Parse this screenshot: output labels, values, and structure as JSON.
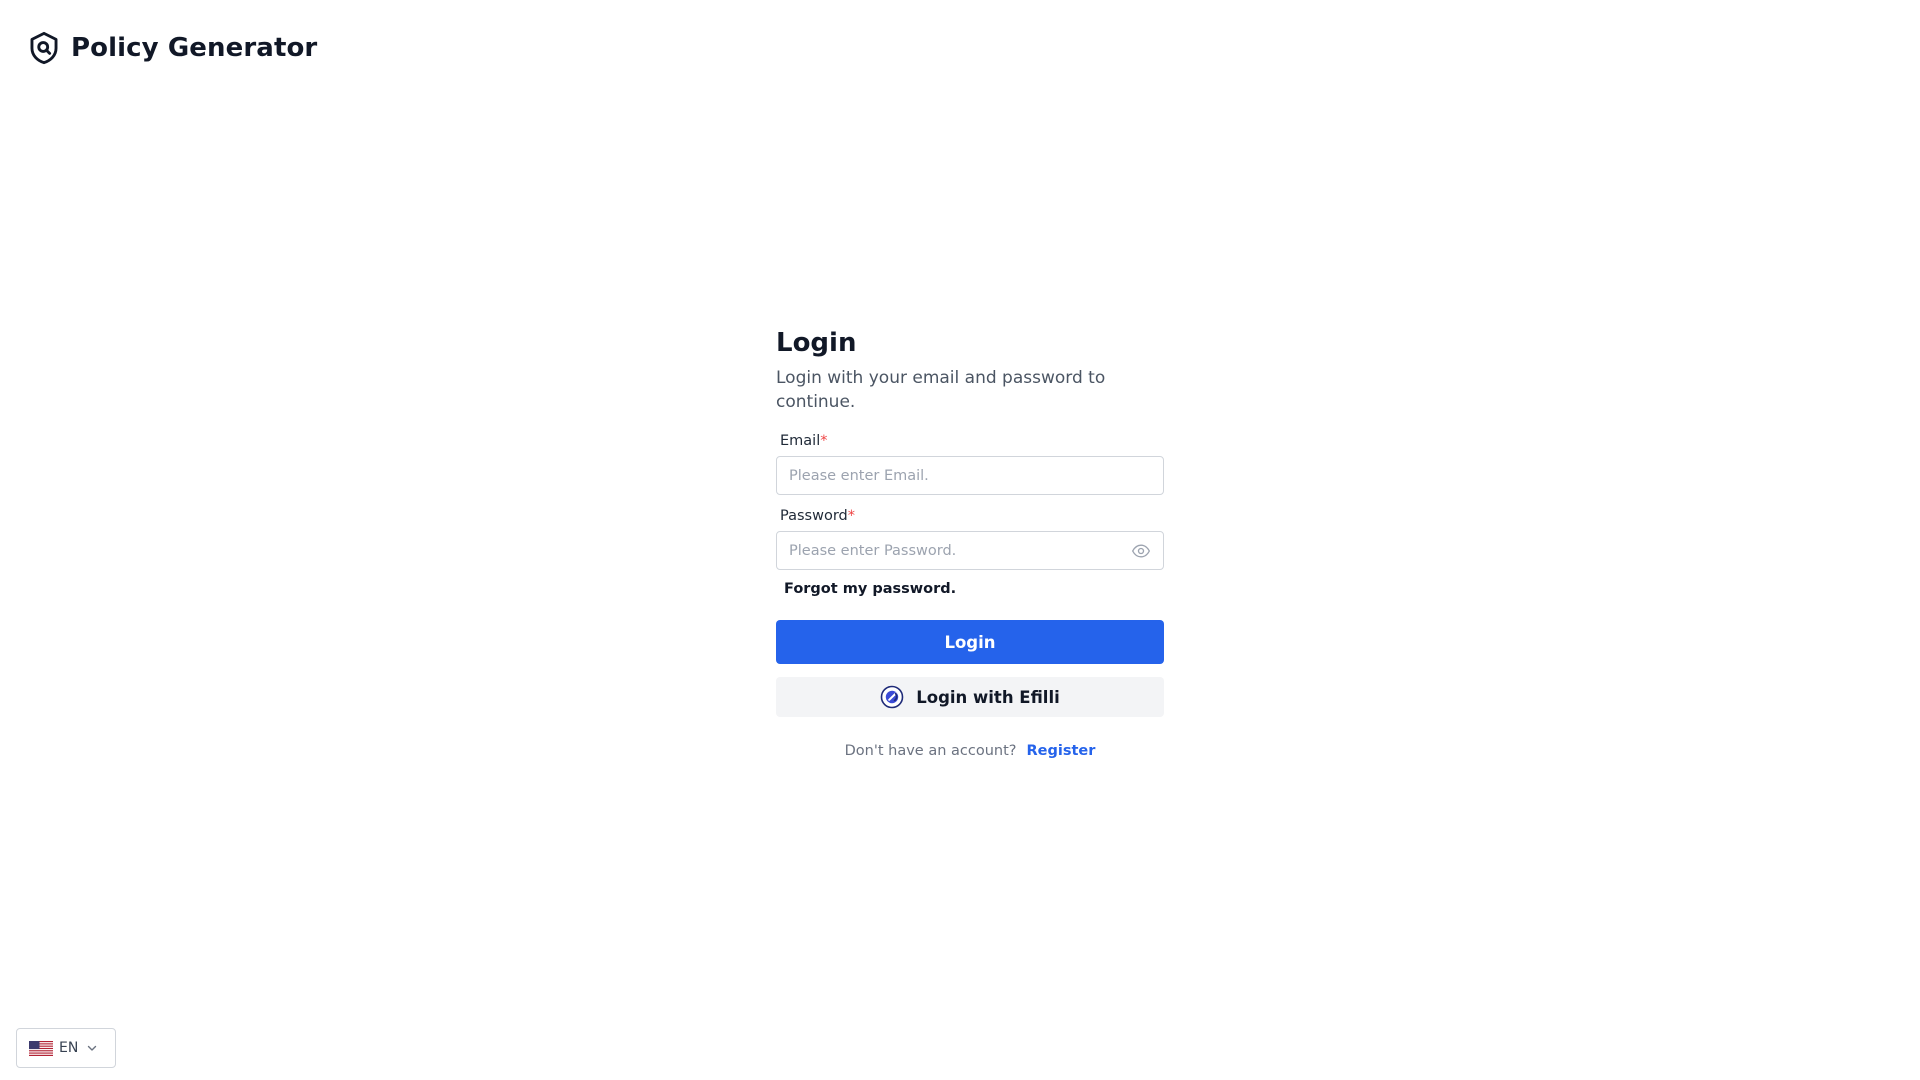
{
  "header": {
    "brand_name": "Policy Generator",
    "brand_icon": "shield-search-icon"
  },
  "login": {
    "title": "Login",
    "subtitle": "Login with your email and password to continue.",
    "email": {
      "label": "Email",
      "required_mark": "*",
      "placeholder": "Please enter Email.",
      "value": ""
    },
    "password": {
      "label": "Password",
      "required_mark": "*",
      "placeholder": "Please enter Password.",
      "value": "",
      "toggle_icon": "eye-icon"
    },
    "forgot_password": "Forgot my password.",
    "submit_label": "Login",
    "efilli_label": "Login with Efilli",
    "efilli_icon": "efilli-logo-icon",
    "register_prompt": "Don't have an account?",
    "register_link": "Register"
  },
  "language": {
    "selected": "EN",
    "flag_icon": "us-flag-icon"
  },
  "colors": {
    "primary": "#2563eb",
    "required": "#ef4444",
    "secondary_button_bg": "#f3f4f6",
    "text": "#111827",
    "muted": "#6b7280"
  }
}
